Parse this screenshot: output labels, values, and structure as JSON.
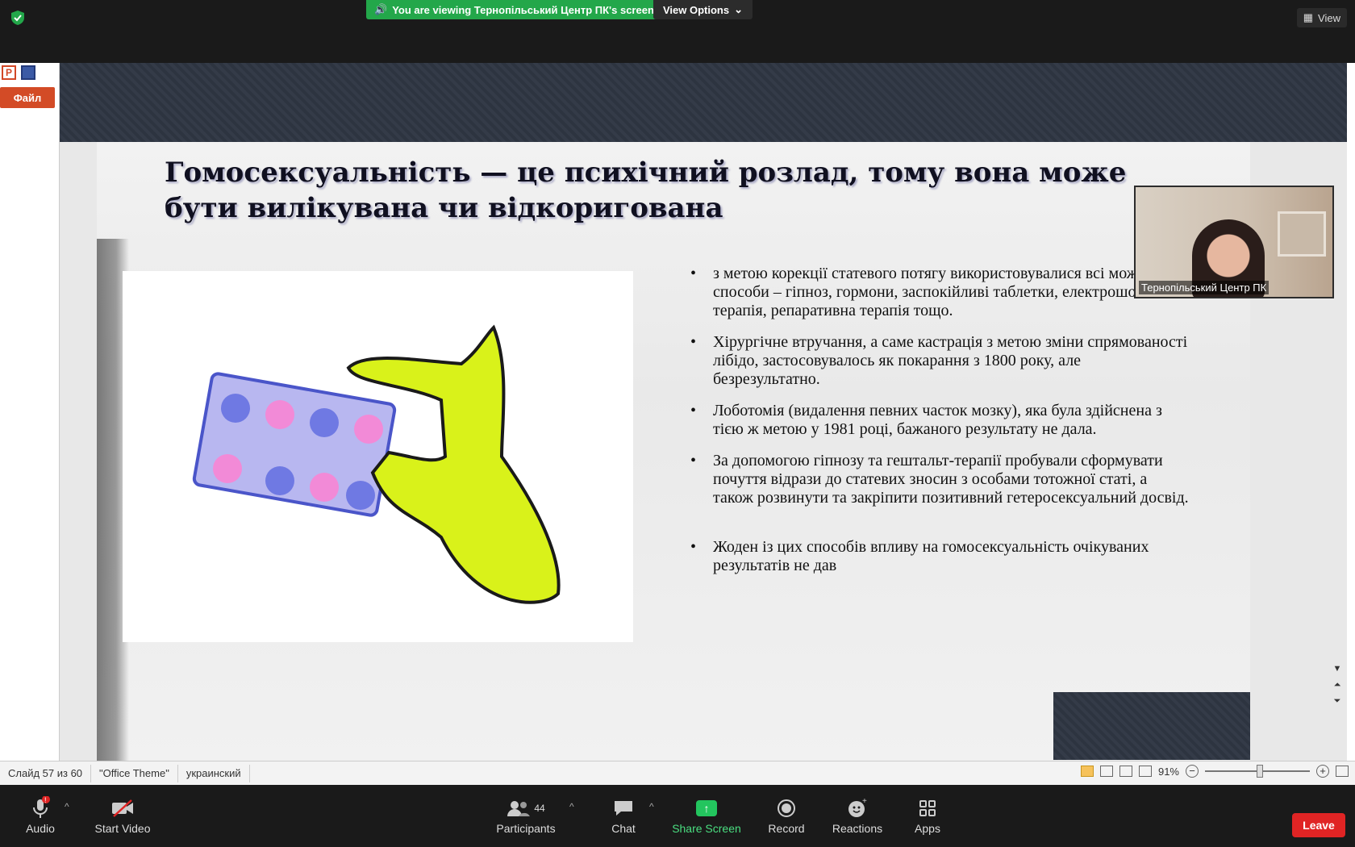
{
  "zoom_meeting": {
    "banner": "You are viewing Тернопільський Центр ПК's screen",
    "view_options": "View Options",
    "view_label": "View"
  },
  "ppt": {
    "file_tab": "Файл",
    "pp_letter": "P",
    "slide": {
      "title": "Гомосексуальність — це психічний розлад, тому вона може бути вилікувана чи відкоригована",
      "bullets": [
        "з метою корекції статевого потягу використовувалися всі можливі способи – гіпноз, гормони, заспокійливі таблетки, електрошокова терапія, репаративна терапія тощо.",
        "Хірургічне втручання, а саме кастрація з метою зміни спрямованості лібідо, застосовувалось як покарання з 1800 року, але безрезультатно.",
        "Лоботомія (видалення певних часток мозку), яка була здійснена з тією ж метою у 1981 році, бажаного результату не дала.",
        "За допомогою гіпнозу та гештальт-терапії пробували сформувати почуття відрази до статевих зносин з особами тотожної статі, а також розвинути та закріпити позитивний гетеросексуальний досвід.",
        "Жоден із цих способів впливу на гомосексуальність очікуваних результатів не дав"
      ]
    },
    "status": {
      "slide": "Слайд 57 из 60",
      "theme": "\"Office Theme\"",
      "language": "украинский",
      "zoom": "91%"
    }
  },
  "video": {
    "name": "Тернопільський Центр ПК"
  },
  "toolbar": {
    "audio": "Audio",
    "start_video": "Start Video",
    "participants": "Participants",
    "participants_count": "44",
    "chat": "Chat",
    "share_screen": "Share Screen",
    "record": "Record",
    "reactions": "Reactions",
    "apps": "Apps",
    "leave": "Leave"
  },
  "colors": {
    "share_green": "#23a74a",
    "leave_red": "#e02424",
    "file_tab": "#d34b26"
  }
}
